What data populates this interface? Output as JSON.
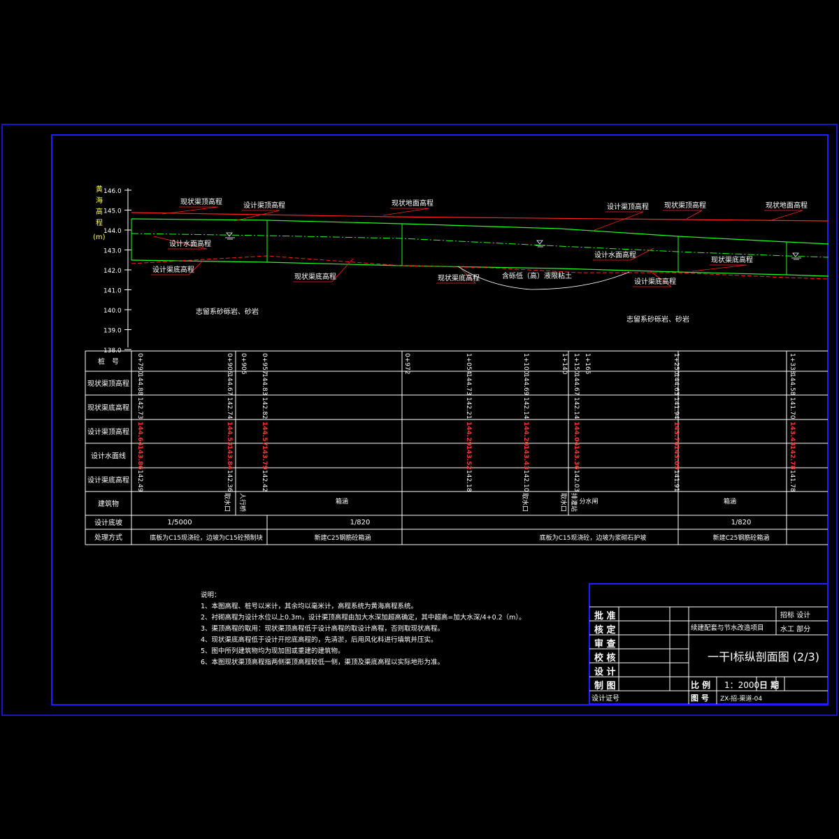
{
  "colors": {
    "background": "#000000",
    "frame": "#2020ff",
    "grid": "#ffffff",
    "existing": "#ff2020",
    "design": "#20ff20",
    "label": "#ffff66"
  },
  "axis": {
    "title_chars": [
      "黄",
      "海",
      "高",
      "程",
      "(m)"
    ],
    "ticks": [
      "146.0",
      "145.0",
      "144.0",
      "143.0",
      "142.0",
      "141.0",
      "140.0",
      "139.0",
      "138.0"
    ]
  },
  "profile_labels": {
    "xz_qdgc_1": "现状渠顶高程",
    "sj_qdgc_1": "设计渠顶高程",
    "xz_dmgc_1": "现状地面高程",
    "sj_qdgc_2": "设计渠顶高程",
    "xz_qdgc_2": "现状渠顶高程",
    "xz_dmgc_2": "现状地面高程",
    "sj_smgc_1": "设计水面高程",
    "sj_qdigc_1": "设计渠底高程",
    "xz_qdigc_1": "现状渠底高程",
    "xz_qdigc_2": "现状渠底高程",
    "clay": "含砾低（高）液限粘土",
    "sj_smgc_2": "设计水面高程",
    "xz_qdigc_3": "现状渠底高程",
    "sj_qdigc_2": "设计渠底高程",
    "rock_1": "志留系砂砾岩、砂岩",
    "rock_2": "志留系砂砾岩、砂岩"
  },
  "table": {
    "row_titles": [
      "桩　号",
      "现状渠顶高程",
      "现状渠底高程",
      "设计渠顶高程",
      "设计水面线",
      "设计渠底高程",
      "建筑物",
      "设计底坡",
      "处理方式"
    ],
    "stations": [
      "0+790",
      "0+906",
      "0+906",
      "0+957",
      "0+972",
      "1+054",
      "1+100",
      "1+140",
      "1+150",
      "1+165",
      "1+250",
      "1+338"
    ],
    "xz_top": [
      "144.88",
      "144.67",
      "144.83",
      "144.73",
      "144.69",
      "144.67",
      "144.63",
      "144.58"
    ],
    "xz_bottom": [
      "142.73",
      "142.74",
      "142.82",
      "142.21",
      "142.14",
      "142.14",
      "141.94",
      "141.70"
    ],
    "sj_top": [
      "144.64",
      "144.53",
      "144.57",
      "144.29",
      "144.20",
      "144.04",
      "143.74",
      "143.43"
    ],
    "sj_water": [
      "143.86",
      "143.84",
      "143.79",
      "143.52",
      "143.43",
      "143.36",
      "143.05",
      "142.78"
    ],
    "sj_bottom": [
      "142.49",
      "142.36",
      "142.42",
      "142.18",
      "142.10",
      "142.03",
      "141.91",
      "141.78"
    ],
    "structures": [
      "取水口",
      "人行桥",
      "箱涵",
      "取水口",
      "取水口",
      "排灌站",
      "分水闸",
      "箱涵"
    ],
    "slopes": [
      "1/5000",
      "1/820",
      "1/820"
    ],
    "methods": [
      "底板为C15现浇砼，边坡为C15砼预制块",
      "新建C25钢筋砼箱涵",
      "底板为C15现浇砼，边坡为浆砌石护坡",
      "新建C25钢筋砼箱涵"
    ]
  },
  "notes": {
    "title": "说明：",
    "lines": [
      "1、本图高程、桩号以米计，其余均以毫米计，高程系统为黄海高程系统。",
      "2、衬砌高程为设计水位以上0.3m，设计渠顶高程由加大水深加超高确定，其中超高=加大水深/4+0.2（m）。",
      "3、渠顶高程的取用：现状渠顶高程低于设计高程的取设计高程，否则取现状高程。",
      "4、现状渠底高程低于设计开挖底高程的，先清淤，后用风化料进行填筑并压实。",
      "5、图中所列建筑物均为现加固或重建的建筑物。",
      "6、本图现状渠顶高程指两侧渠顶高程较低一侧，渠顶及渠底高程以实际地形为准。"
    ]
  },
  "title_block": {
    "roles": [
      "批 准",
      "核 定",
      "审 查",
      "校 核",
      "设 计",
      "制 图"
    ],
    "cert": "设计证号",
    "project": "续建配套与节水改造项目",
    "stage": "招标 设计",
    "part": "水工 部分",
    "drawing_title": "一干Ⅰ标纵剖面图 (2/3)",
    "scale_label": "比 例",
    "scale": "1：2000",
    "date_label": "日 期",
    "no_label": "图 号",
    "no": "ZX-招-渠道-04"
  }
}
